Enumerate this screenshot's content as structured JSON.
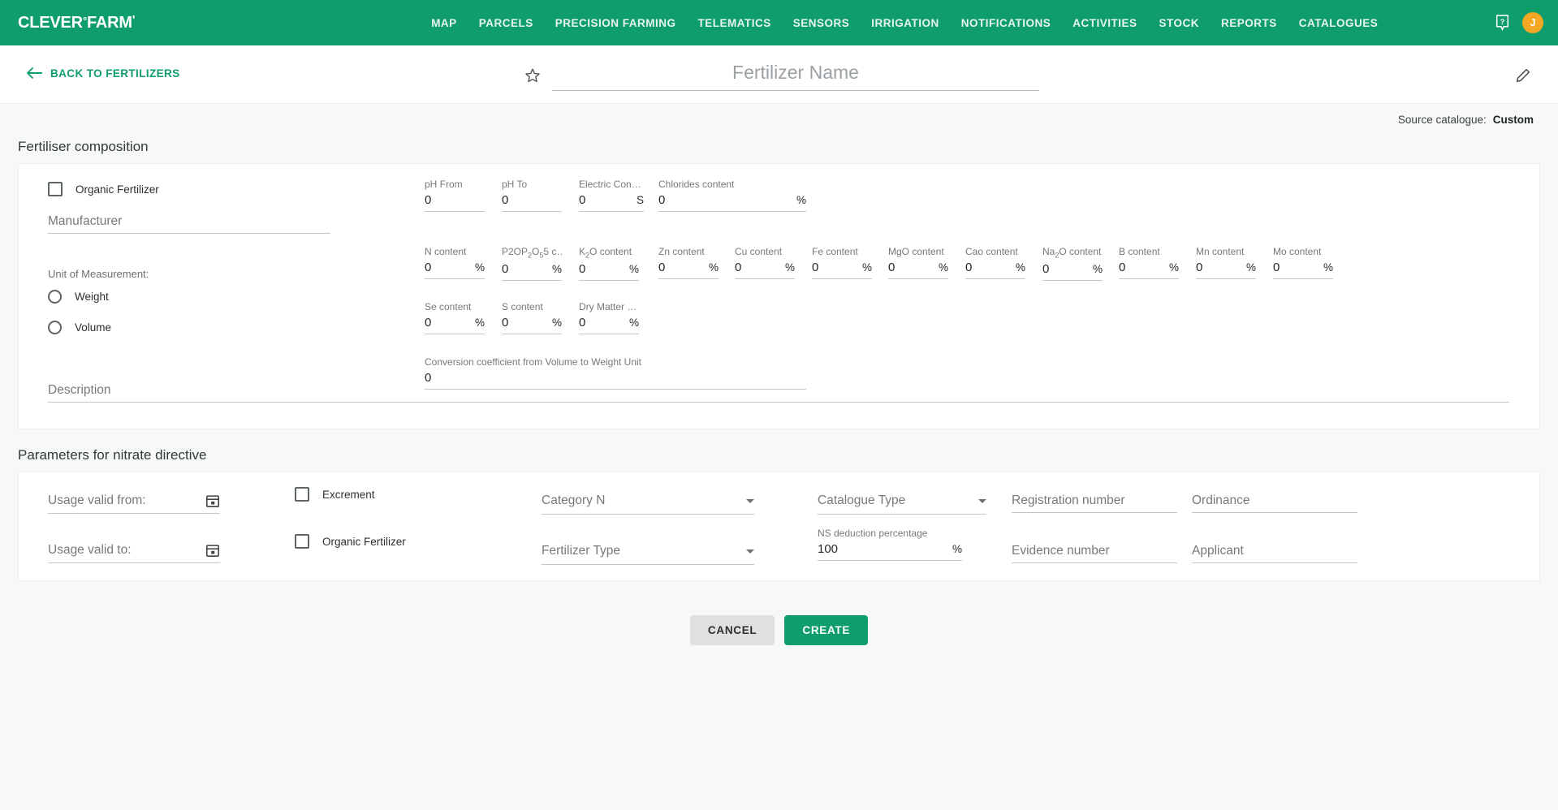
{
  "brand": {
    "name_main": "CLEVER",
    "degree": "°",
    "name_second": "FARM",
    "tick": "'"
  },
  "nav": {
    "items": [
      {
        "label": "MAP"
      },
      {
        "label": "PARCELS"
      },
      {
        "label": "PRECISION FARMING"
      },
      {
        "label": "TELEMATICS"
      },
      {
        "label": "SENSORS"
      },
      {
        "label": "IRRIGATION"
      },
      {
        "label": "NOTIFICATIONS"
      },
      {
        "label": "ACTIVITIES"
      },
      {
        "label": "STOCK"
      },
      {
        "label": "REPORTS"
      },
      {
        "label": "CATALOGUES"
      }
    ],
    "help_icon": "help-question-icon",
    "avatar_initial": "J",
    "avatar_color": "#f5a623"
  },
  "header": {
    "back_label": "BACK TO FERTILIZERS",
    "back_icon": "arrow-left-icon",
    "favorite_icon": "star-outline-icon",
    "edit_icon": "pencil-icon",
    "title_value": "",
    "title_placeholder": "Fertilizer Name"
  },
  "source_catalogue": {
    "label": "Source catalogue:",
    "value": "Custom"
  },
  "composition": {
    "section_title": "Fertiliser composition",
    "organic_checkbox": {
      "label": "Organic Fertilizer",
      "checked": false
    },
    "manufacturer": {
      "placeholder": "Manufacturer",
      "value": ""
    },
    "unit_caption": "Unit of Measurement:",
    "unit_options": [
      {
        "label": "Weight",
        "selected": false
      },
      {
        "label": "Volume",
        "selected": false
      }
    ],
    "description": {
      "placeholder": "Description",
      "value": ""
    },
    "ph_row": [
      {
        "label": "pH From",
        "value": "0",
        "suffix": ""
      },
      {
        "label": "pH To",
        "value": "0",
        "suffix": ""
      },
      {
        "label": "Electric Con…",
        "value": "0",
        "suffix": "S"
      },
      {
        "label": "Chlorides content",
        "value": "0",
        "suffix": "%"
      }
    ],
    "nutrients_row": [
      {
        "label": "N content",
        "value": "0",
        "suffix": "%"
      },
      {
        "label": "P2OP2O55 c…",
        "value": "0",
        "suffix": "%"
      },
      {
        "label": "K2O content",
        "value": "0",
        "suffix": "%"
      },
      {
        "label": "Zn content",
        "value": "0",
        "suffix": "%"
      },
      {
        "label": "Cu content",
        "value": "0",
        "suffix": "%"
      },
      {
        "label": "Fe content",
        "value": "0",
        "suffix": "%"
      },
      {
        "label": "MgO content",
        "value": "0",
        "suffix": "%"
      },
      {
        "label": "Cao content",
        "value": "0",
        "suffix": "%"
      },
      {
        "label": "Na2O content",
        "value": "0",
        "suffix": "%"
      },
      {
        "label": "B content",
        "value": "0",
        "suffix": "%"
      },
      {
        "label": "Mn content",
        "value": "0",
        "suffix": "%"
      },
      {
        "label": "Mo content",
        "value": "0",
        "suffix": "%"
      }
    ],
    "trace_row": [
      {
        "label": "Se content",
        "value": "0",
        "suffix": "%"
      },
      {
        "label": "S content",
        "value": "0",
        "suffix": "%"
      },
      {
        "label": "Dry Matter …",
        "value": "0",
        "suffix": "%"
      }
    ],
    "conversion": {
      "label": "Conversion coefficient from Volume to Weight Unit",
      "value": "0"
    }
  },
  "nitrate": {
    "section_title": "Parameters for nitrate directive",
    "valid_from": {
      "placeholder": "Usage valid from:",
      "value": "",
      "icon": "calendar-icon"
    },
    "valid_to": {
      "placeholder": "Usage valid to:",
      "value": "",
      "icon": "calendar-icon"
    },
    "excrement_checkbox": {
      "label": "Excrement",
      "checked": false
    },
    "organic_checkbox": {
      "label": "Organic Fertilizer",
      "checked": false
    },
    "category_n": {
      "label": "Category N",
      "icon": "chevron-down-icon"
    },
    "fertilizer_type": {
      "label": "Fertilizer Type",
      "icon": "chevron-down-icon"
    },
    "catalogue_type": {
      "label": "Catalogue Type",
      "icon": "chevron-down-icon"
    },
    "ns_deduction": {
      "label": "NS deduction percentage",
      "value": "100",
      "suffix": "%"
    },
    "registration_number": {
      "placeholder": "Registration number",
      "value": ""
    },
    "evidence_number": {
      "placeholder": "Evidence number",
      "value": ""
    },
    "ordinance": {
      "placeholder": "Ordinance",
      "value": ""
    },
    "applicant": {
      "placeholder": "Applicant",
      "value": ""
    }
  },
  "footer": {
    "cancel_label": "CANCEL",
    "create_label": "CREATE"
  },
  "colors": {
    "brand_green": "#0f9d6e",
    "page_bg": "#f7f8f8",
    "accent_orange": "#f5a623"
  }
}
